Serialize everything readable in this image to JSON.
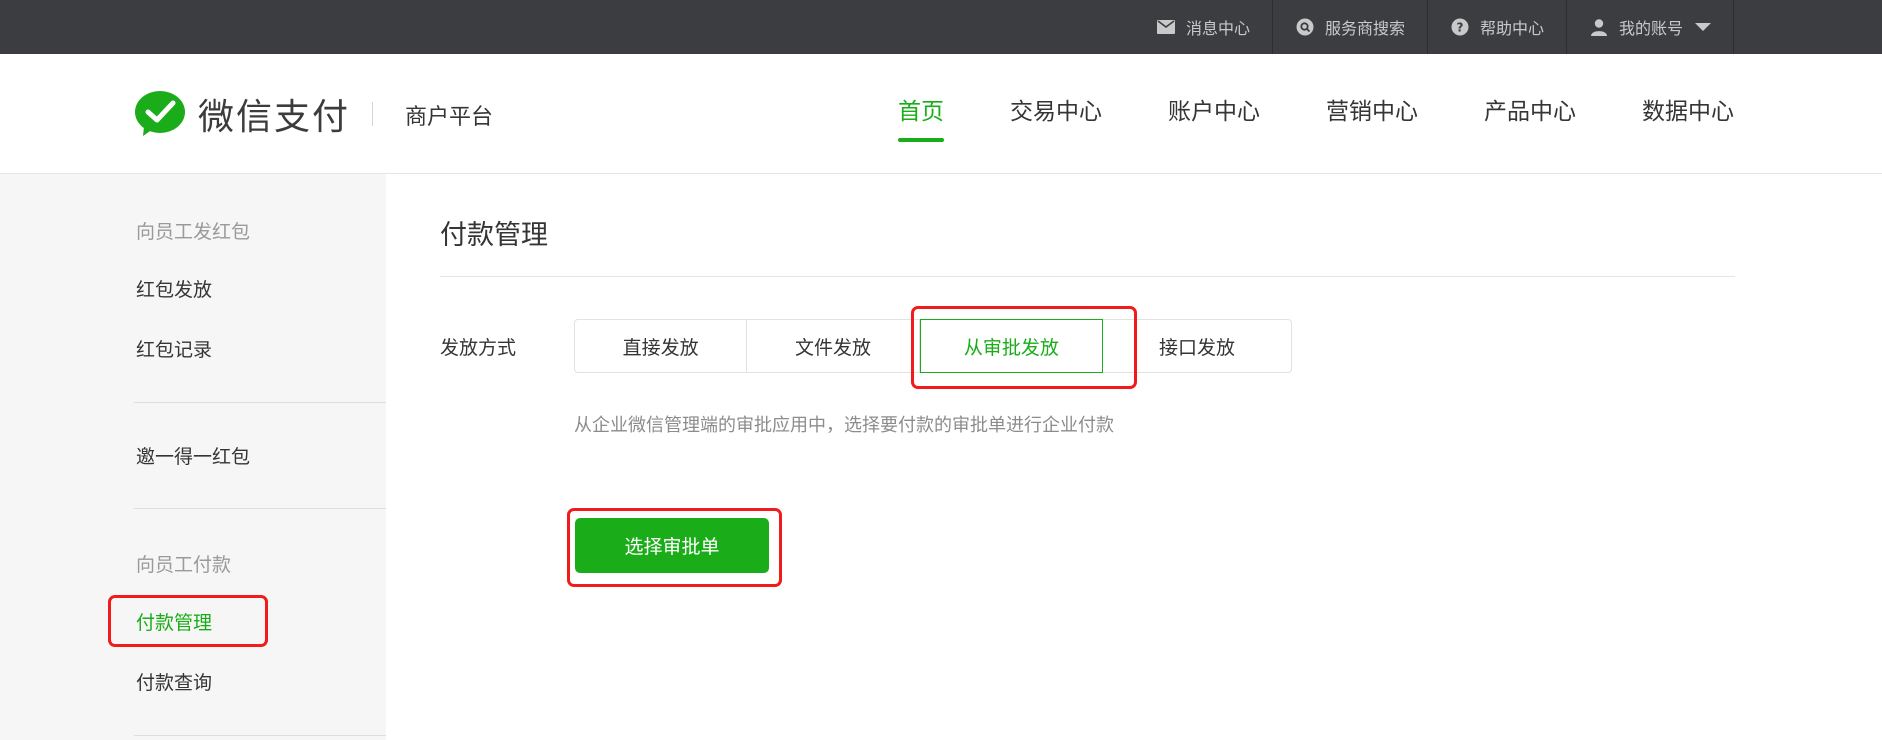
{
  "topbar": {
    "links": [
      {
        "label": "消息中心",
        "icon": "mail-icon"
      },
      {
        "label": "服务商搜索",
        "icon": "search-icon"
      },
      {
        "label": "帮助中心",
        "icon": "help-icon"
      },
      {
        "label": "我的账号",
        "icon": "user-icon"
      }
    ]
  },
  "header": {
    "logo_text": "微信支付",
    "platform": "商户平台",
    "nav": [
      {
        "label": "首页",
        "active": true
      },
      {
        "label": "交易中心"
      },
      {
        "label": "账户中心"
      },
      {
        "label": "营销中心"
      },
      {
        "label": "产品中心"
      },
      {
        "label": "数据中心"
      }
    ]
  },
  "sidebar": {
    "group1_title": "向员工发红包",
    "item_hongbao_send": "红包发放",
    "item_hongbao_record": "红包记录",
    "item_invite": "邀一得一红包",
    "group2_title": "向员工付款",
    "item_payment_manage": "付款管理",
    "item_payment_query": "付款查询"
  },
  "main": {
    "title": "付款管理",
    "field_label": "发放方式",
    "tabs": [
      "直接发放",
      "文件发放",
      "从审批发放",
      "接口发放"
    ],
    "active_tab": "从审批发放",
    "description": "从企业微信管理端的审批应用中，选择要付款的审批单进行企业付款",
    "primary_button": "选择审批单"
  },
  "colors": {
    "brand_green": "#1aad19",
    "topbar_bg": "#3c3d41",
    "annotation_red": "#f21b1b"
  }
}
